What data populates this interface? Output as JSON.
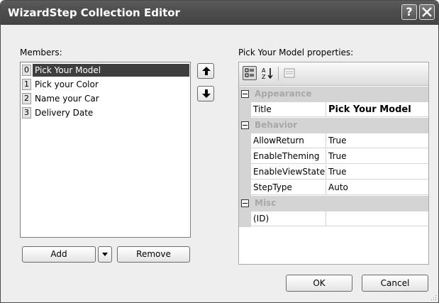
{
  "window": {
    "title": "WizardStep Collection Editor",
    "help_glyph": "?"
  },
  "members": {
    "label": "Members:",
    "items": [
      {
        "index": "0",
        "label": "Pick Your Model",
        "selected": true
      },
      {
        "index": "1",
        "label": "Pick your Color"
      },
      {
        "index": "2",
        "label": "Name your Car"
      },
      {
        "index": "3",
        "label": "Delivery Date"
      }
    ],
    "add_label": "Add",
    "remove_label": "Remove"
  },
  "properties": {
    "label": "Pick Your Model properties:",
    "categories": [
      {
        "name": "Appearance",
        "props": [
          {
            "name": "Title",
            "value": "Pick Your Model",
            "bold": true
          }
        ]
      },
      {
        "name": "Behavior",
        "props": [
          {
            "name": "AllowReturn",
            "value": "True"
          },
          {
            "name": "EnableTheming",
            "value": "True"
          },
          {
            "name": "EnableViewState",
            "value": "True"
          },
          {
            "name": "StepType",
            "value": "Auto"
          }
        ]
      },
      {
        "name": "Misc",
        "props": [
          {
            "name": "(ID)",
            "value": ""
          }
        ]
      }
    ]
  },
  "dialog": {
    "ok_label": "OK",
    "cancel_label": "Cancel"
  },
  "icons": {
    "help": "help-icon",
    "close": "close-icon",
    "move_up": "arrow-up-icon",
    "move_down": "arrow-down-icon",
    "add_dropdown": "chevron-down-icon",
    "categorized": "categorized-icon",
    "alphabetical": "sort-alphabetical-icon",
    "property_pages": "property-pages-icon",
    "resize": "resize-grip-icon"
  },
  "colors": {
    "titlebar": "#4e4e4e",
    "selection": "#3e3e3e",
    "category_bg": "#d4d4d4",
    "category_text": "#a8a8a8"
  }
}
